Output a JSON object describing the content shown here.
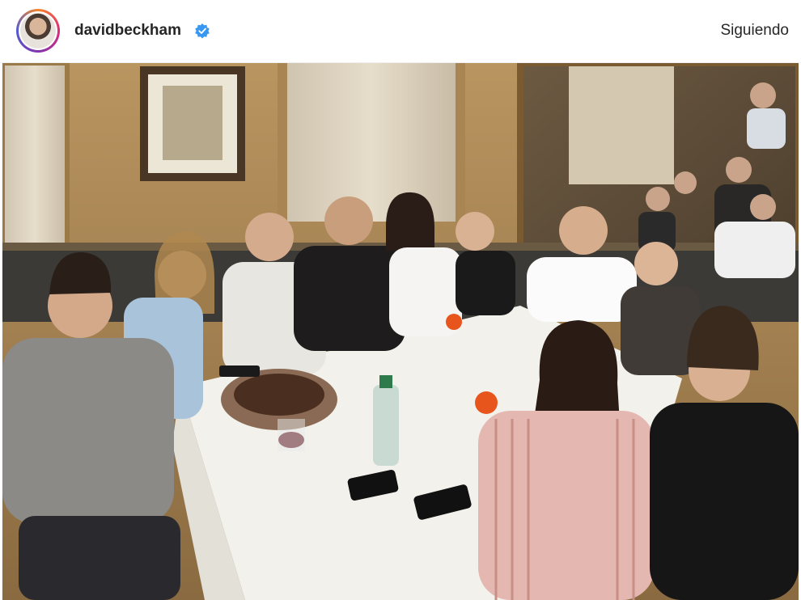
{
  "header": {
    "username": "davidbeckham",
    "verified_icon": "verified-badge-icon",
    "follow_status": "Siguiendo"
  },
  "photo": {
    "subject": "group-dinner-photo"
  },
  "colors": {
    "verified": "#3897f0",
    "text": "#262626"
  }
}
